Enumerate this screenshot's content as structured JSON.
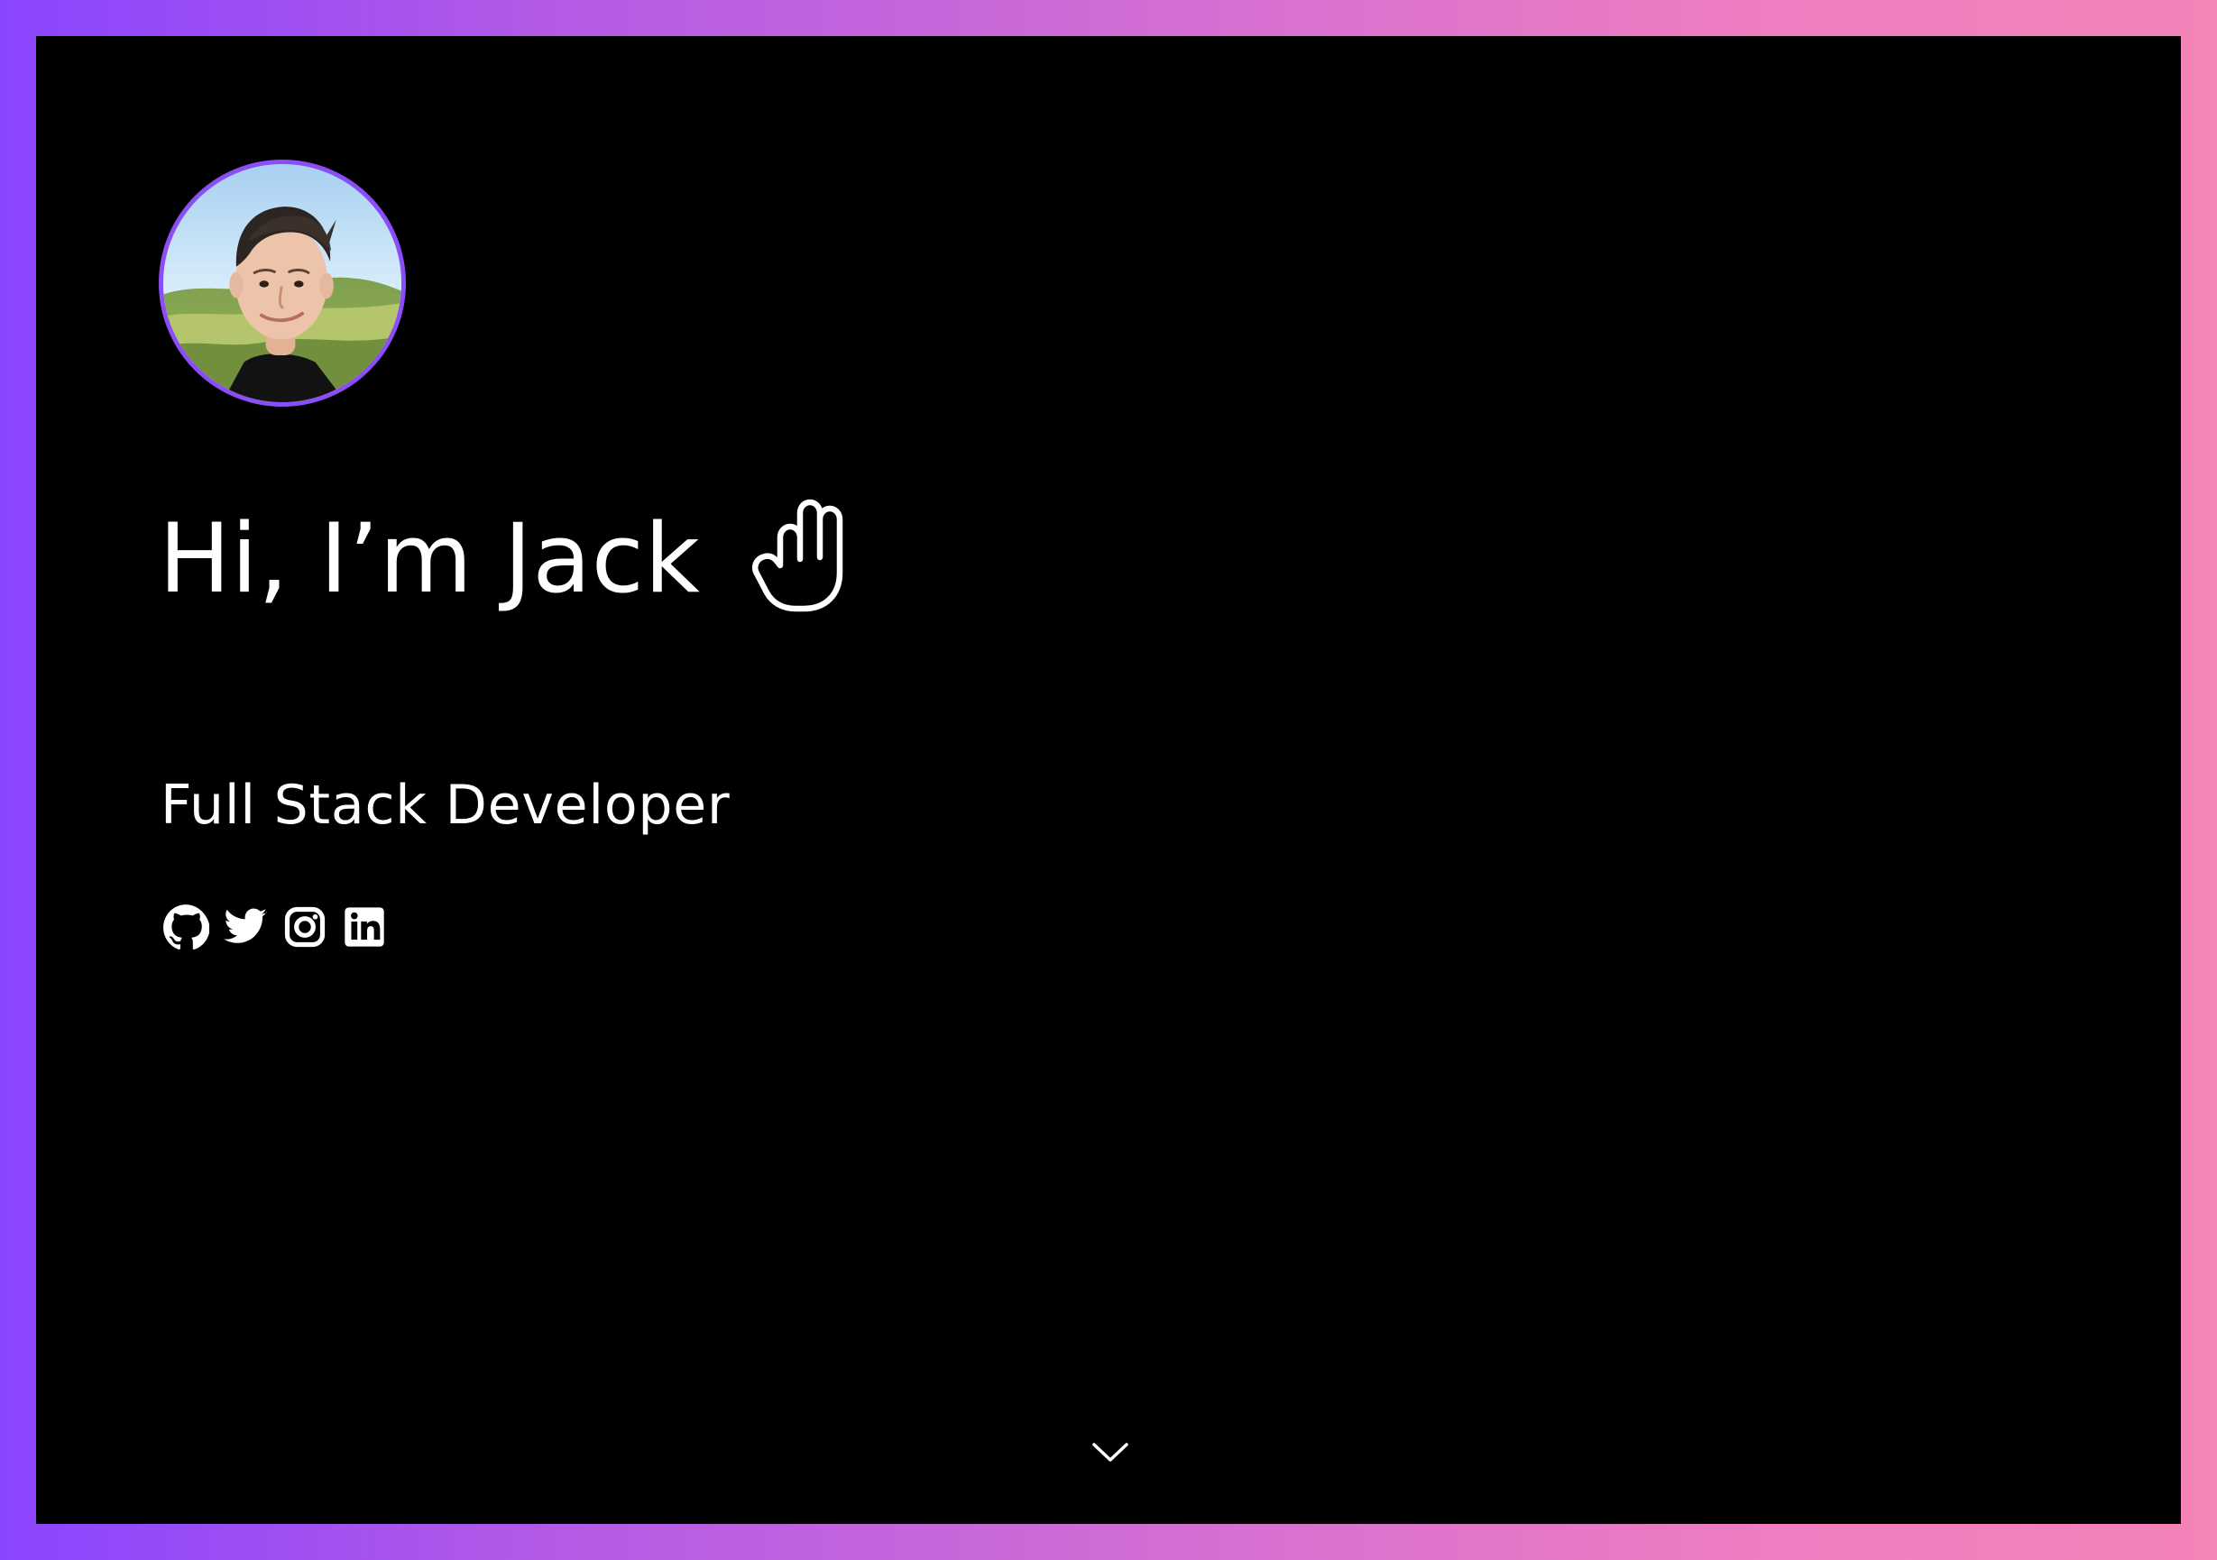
{
  "hero": {
    "title": "Hi, I’m Jack",
    "subtitle": "Full Stack Developer"
  },
  "icons": {
    "avatar": "avatar",
    "wave": "hand-wave-icon",
    "github": "github-icon",
    "twitter": "twitter-icon",
    "instagram": "instagram-icon",
    "linkedin": "linkedin-icon",
    "scroll": "chevron-down-icon"
  },
  "colors": {
    "background": "#000000",
    "frame_start": "#8b45ff",
    "frame_end": "#f483b8",
    "avatar_ring": "#8b4df6",
    "text": "#ffffff"
  }
}
